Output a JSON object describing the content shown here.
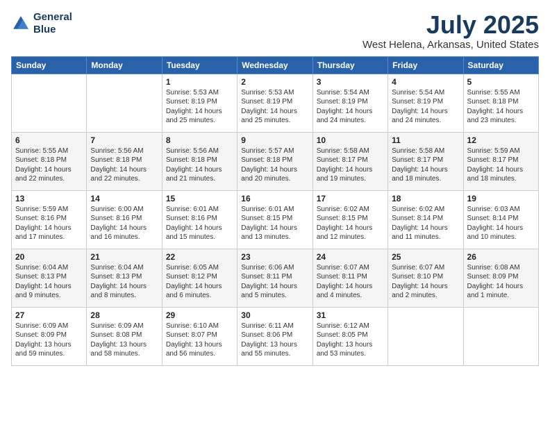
{
  "header": {
    "logo_line1": "General",
    "logo_line2": "Blue",
    "month": "July 2025",
    "location": "West Helena, Arkansas, United States"
  },
  "weekdays": [
    "Sunday",
    "Monday",
    "Tuesday",
    "Wednesday",
    "Thursday",
    "Friday",
    "Saturday"
  ],
  "weeks": [
    [
      {
        "day": "",
        "text": ""
      },
      {
        "day": "",
        "text": ""
      },
      {
        "day": "1",
        "text": "Sunrise: 5:53 AM\nSunset: 8:19 PM\nDaylight: 14 hours\nand 25 minutes."
      },
      {
        "day": "2",
        "text": "Sunrise: 5:53 AM\nSunset: 8:19 PM\nDaylight: 14 hours\nand 25 minutes."
      },
      {
        "day": "3",
        "text": "Sunrise: 5:54 AM\nSunset: 8:19 PM\nDaylight: 14 hours\nand 24 minutes."
      },
      {
        "day": "4",
        "text": "Sunrise: 5:54 AM\nSunset: 8:19 PM\nDaylight: 14 hours\nand 24 minutes."
      },
      {
        "day": "5",
        "text": "Sunrise: 5:55 AM\nSunset: 8:18 PM\nDaylight: 14 hours\nand 23 minutes."
      }
    ],
    [
      {
        "day": "6",
        "text": "Sunrise: 5:55 AM\nSunset: 8:18 PM\nDaylight: 14 hours\nand 22 minutes."
      },
      {
        "day": "7",
        "text": "Sunrise: 5:56 AM\nSunset: 8:18 PM\nDaylight: 14 hours\nand 22 minutes."
      },
      {
        "day": "8",
        "text": "Sunrise: 5:56 AM\nSunset: 8:18 PM\nDaylight: 14 hours\nand 21 minutes."
      },
      {
        "day": "9",
        "text": "Sunrise: 5:57 AM\nSunset: 8:18 PM\nDaylight: 14 hours\nand 20 minutes."
      },
      {
        "day": "10",
        "text": "Sunrise: 5:58 AM\nSunset: 8:17 PM\nDaylight: 14 hours\nand 19 minutes."
      },
      {
        "day": "11",
        "text": "Sunrise: 5:58 AM\nSunset: 8:17 PM\nDaylight: 14 hours\nand 18 minutes."
      },
      {
        "day": "12",
        "text": "Sunrise: 5:59 AM\nSunset: 8:17 PM\nDaylight: 14 hours\nand 18 minutes."
      }
    ],
    [
      {
        "day": "13",
        "text": "Sunrise: 5:59 AM\nSunset: 8:16 PM\nDaylight: 14 hours\nand 17 minutes."
      },
      {
        "day": "14",
        "text": "Sunrise: 6:00 AM\nSunset: 8:16 PM\nDaylight: 14 hours\nand 16 minutes."
      },
      {
        "day": "15",
        "text": "Sunrise: 6:01 AM\nSunset: 8:16 PM\nDaylight: 14 hours\nand 15 minutes."
      },
      {
        "day": "16",
        "text": "Sunrise: 6:01 AM\nSunset: 8:15 PM\nDaylight: 14 hours\nand 13 minutes."
      },
      {
        "day": "17",
        "text": "Sunrise: 6:02 AM\nSunset: 8:15 PM\nDaylight: 14 hours\nand 12 minutes."
      },
      {
        "day": "18",
        "text": "Sunrise: 6:02 AM\nSunset: 8:14 PM\nDaylight: 14 hours\nand 11 minutes."
      },
      {
        "day": "19",
        "text": "Sunrise: 6:03 AM\nSunset: 8:14 PM\nDaylight: 14 hours\nand 10 minutes."
      }
    ],
    [
      {
        "day": "20",
        "text": "Sunrise: 6:04 AM\nSunset: 8:13 PM\nDaylight: 14 hours\nand 9 minutes."
      },
      {
        "day": "21",
        "text": "Sunrise: 6:04 AM\nSunset: 8:13 PM\nDaylight: 14 hours\nand 8 minutes."
      },
      {
        "day": "22",
        "text": "Sunrise: 6:05 AM\nSunset: 8:12 PM\nDaylight: 14 hours\nand 6 minutes."
      },
      {
        "day": "23",
        "text": "Sunrise: 6:06 AM\nSunset: 8:11 PM\nDaylight: 14 hours\nand 5 minutes."
      },
      {
        "day": "24",
        "text": "Sunrise: 6:07 AM\nSunset: 8:11 PM\nDaylight: 14 hours\nand 4 minutes."
      },
      {
        "day": "25",
        "text": "Sunrise: 6:07 AM\nSunset: 8:10 PM\nDaylight: 14 hours\nand 2 minutes."
      },
      {
        "day": "26",
        "text": "Sunrise: 6:08 AM\nSunset: 8:09 PM\nDaylight: 14 hours\nand 1 minute."
      }
    ],
    [
      {
        "day": "27",
        "text": "Sunrise: 6:09 AM\nSunset: 8:09 PM\nDaylight: 13 hours\nand 59 minutes."
      },
      {
        "day": "28",
        "text": "Sunrise: 6:09 AM\nSunset: 8:08 PM\nDaylight: 13 hours\nand 58 minutes."
      },
      {
        "day": "29",
        "text": "Sunrise: 6:10 AM\nSunset: 8:07 PM\nDaylight: 13 hours\nand 56 minutes."
      },
      {
        "day": "30",
        "text": "Sunrise: 6:11 AM\nSunset: 8:06 PM\nDaylight: 13 hours\nand 55 minutes."
      },
      {
        "day": "31",
        "text": "Sunrise: 6:12 AM\nSunset: 8:05 PM\nDaylight: 13 hours\nand 53 minutes."
      },
      {
        "day": "",
        "text": ""
      },
      {
        "day": "",
        "text": ""
      }
    ]
  ]
}
